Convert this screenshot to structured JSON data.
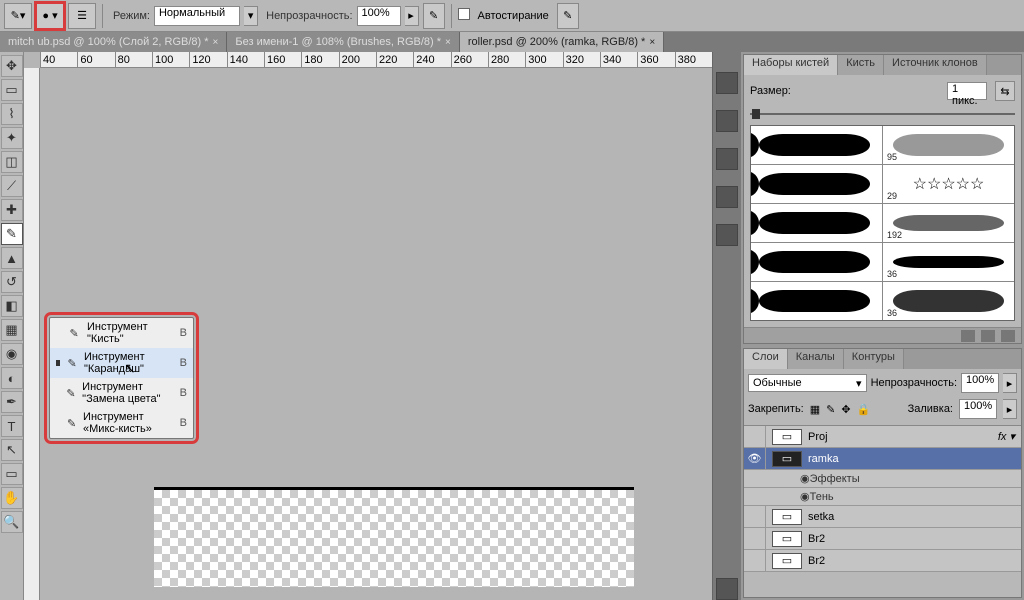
{
  "options": {
    "mode_label": "Режим:",
    "mode_value": "Нормальный",
    "opacity_label": "Непрозрачность:",
    "opacity_value": "100%",
    "autoerase_label": "Автостирание"
  },
  "tabs": [
    {
      "label": "mitch ub.psd @ 100% (Слой 2, RGB/8) *"
    },
    {
      "label": "Без имени-1 @ 108% (Brushes, RGB/8) *"
    },
    {
      "label": "roller.psd @ 200% (ramka, RGB/8) *"
    }
  ],
  "flyout": {
    "items": [
      {
        "label": "Инструмент \"Кисть\"",
        "key": "B",
        "sel": false
      },
      {
        "label": "Инструмент \"Карандаш\"",
        "key": "B",
        "sel": true
      },
      {
        "label": "Инструмент \"Замена цвета\"",
        "key": "B",
        "sel": false
      },
      {
        "label": "Инструмент «Микс-кисть»",
        "key": "B",
        "sel": false
      }
    ]
  },
  "brushes_panel": {
    "tabs": [
      "Наборы кистей",
      "Кисть",
      "Источник клонов"
    ],
    "size_label": "Размер:",
    "size_value": "1 пикс.",
    "samples": [
      "",
      "95",
      "29",
      "192",
      "36",
      "36"
    ]
  },
  "layers_panel": {
    "tabs": [
      "Слои",
      "Каналы",
      "Контуры"
    ],
    "blend_value": "Обычные",
    "opacity_label": "Непрозрачность:",
    "opacity_value": "100%",
    "lock_label": "Закрепить:",
    "fill_label": "Заливка:",
    "fill_value": "100%",
    "layers": [
      {
        "name": "Proj",
        "fx": true,
        "sel": false
      },
      {
        "name": "ramka",
        "fx": false,
        "sel": true
      },
      {
        "name": "Эффекты",
        "fx": false,
        "sel": false,
        "sub": true
      },
      {
        "name": "Тень",
        "fx": false,
        "sel": false,
        "sub": true
      },
      {
        "name": "setka",
        "fx": false,
        "sel": false
      },
      {
        "name": "Br2",
        "fx": false,
        "sel": false
      },
      {
        "name": "Br2",
        "fx": false,
        "sel": false
      }
    ]
  },
  "ruler_marks": [
    "40",
    "60",
    "80",
    "100",
    "120",
    "140",
    "160",
    "180",
    "200",
    "220",
    "240",
    "260",
    "280",
    "300",
    "320",
    "340",
    "360",
    "380"
  ]
}
